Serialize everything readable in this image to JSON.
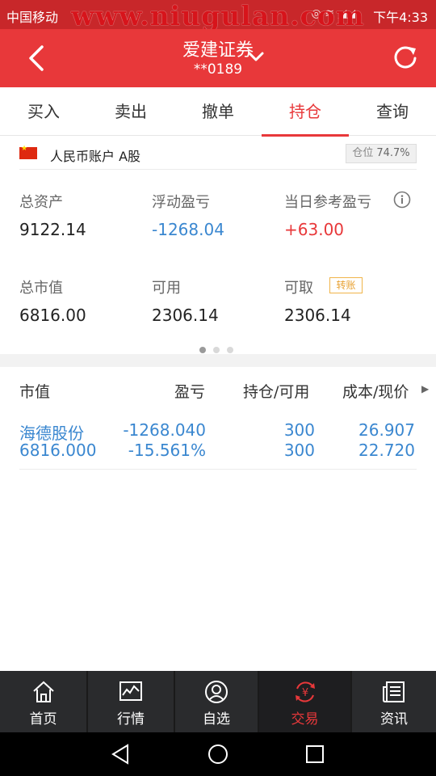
{
  "status_bar": {
    "carrier": "中国移动",
    "watermark": "www.niugulan.com",
    "time": "下午4:33"
  },
  "header": {
    "title": "爱建证券",
    "account_masked": "**0189",
    "icons": [
      "back-arrow-icon",
      "chevron-down-icon",
      "refresh-icon"
    ]
  },
  "tabs": [
    {
      "label": "买入",
      "active": false
    },
    {
      "label": "卖出",
      "active": false
    },
    {
      "label": "撤单",
      "active": false
    },
    {
      "label": "持仓",
      "active": true
    },
    {
      "label": "查询",
      "active": false
    }
  ],
  "account": {
    "label": "人民币账户 A股",
    "position_label": "仓位",
    "position_value": "74.7%"
  },
  "metrics": {
    "total_assets_label": "总资产",
    "total_assets_value": "9122.14",
    "floating_pl_label": "浮动盈亏",
    "floating_pl_value": "-1268.04",
    "daily_pl_label": "当日参考盈亏",
    "daily_pl_value": "+63.00",
    "market_value_label": "总市值",
    "market_value_value": "6816.00",
    "available_label": "可用",
    "available_value": "2306.14",
    "withdrawable_label": "可取",
    "withdrawable_value": "2306.14",
    "transfer_label": "转账"
  },
  "pager": {
    "count": 3,
    "active_index": 0
  },
  "holdings": {
    "headers": [
      "市值",
      "盈亏",
      "持仓/可用",
      "成本/现价"
    ],
    "rows": [
      {
        "name": "海德股份",
        "market_value": "6816.000",
        "pl": "-1268.040",
        "pl_pct": "-15.561%",
        "position": "300",
        "available": "300",
        "cost": "26.907",
        "price": "22.720"
      }
    ]
  },
  "bottom_nav": [
    {
      "label": "首页",
      "icon": "home-icon",
      "active": false
    },
    {
      "label": "行情",
      "icon": "chart-icon",
      "active": false
    },
    {
      "label": "自选",
      "icon": "person-icon",
      "active": false
    },
    {
      "label": "交易",
      "icon": "yen-exchange-icon",
      "active": true
    },
    {
      "label": "资讯",
      "icon": "news-icon",
      "active": false
    }
  ],
  "colors": {
    "brand_red": "#e8383a",
    "status_red": "#c8272a",
    "blue": "#3a87d0",
    "nav_bg": "#2a2b2d"
  }
}
